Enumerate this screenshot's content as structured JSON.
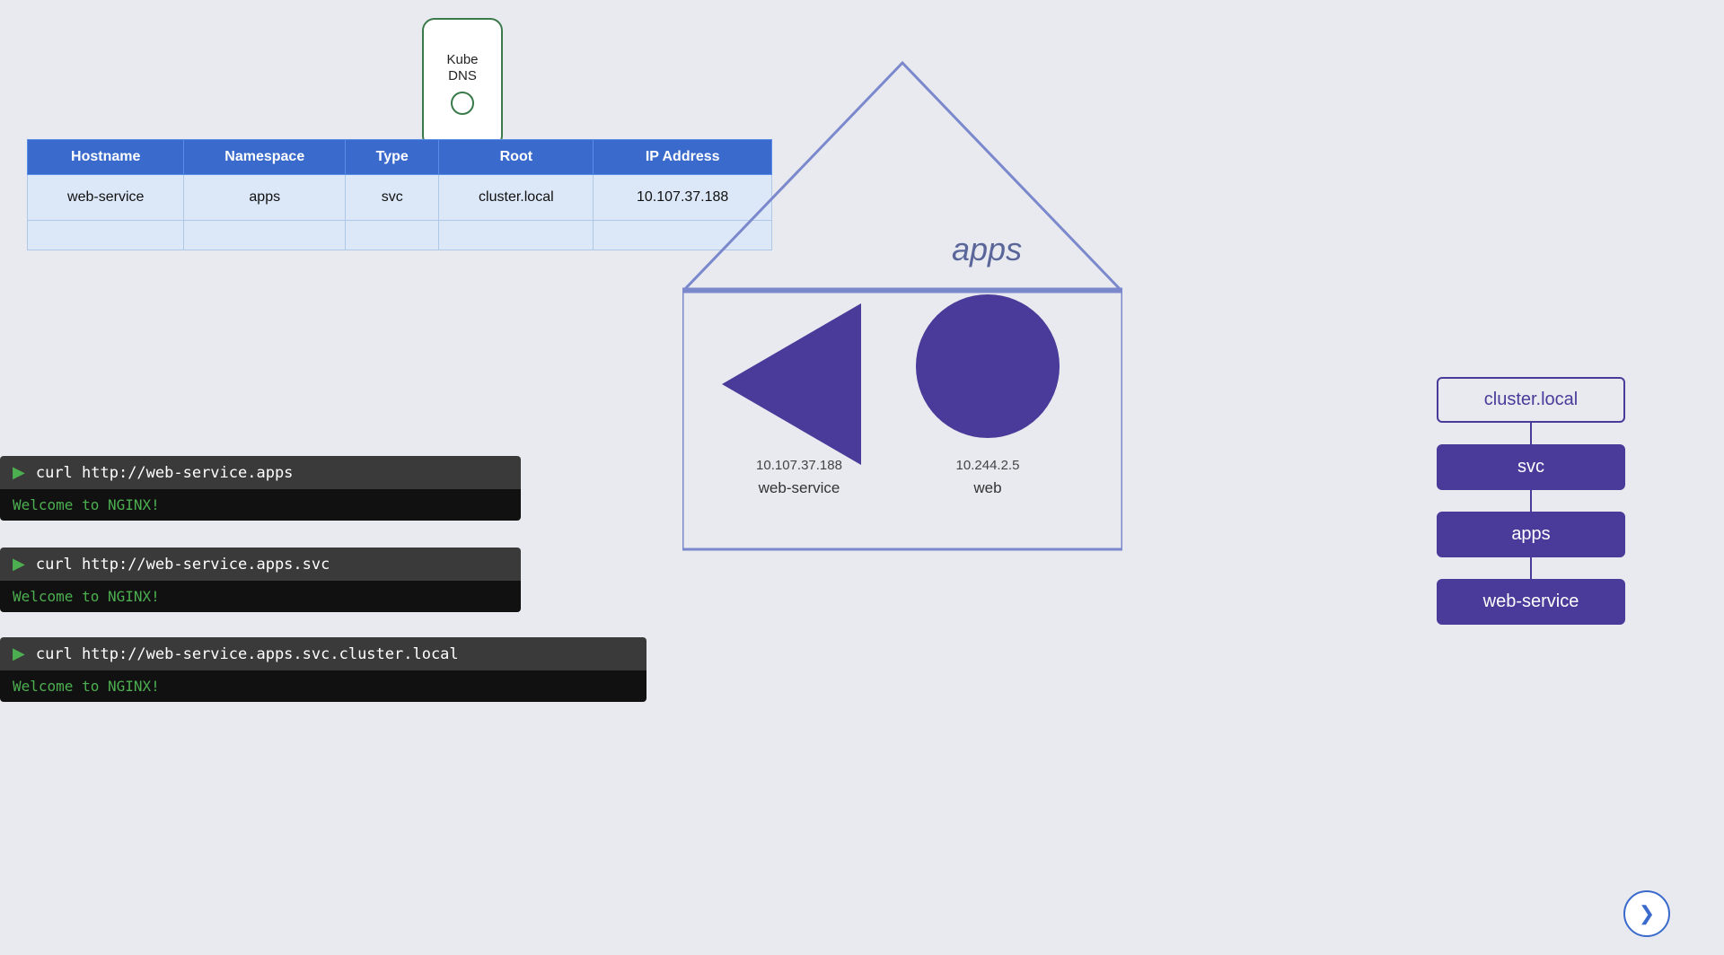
{
  "kubedns": {
    "label": "Kube\nDNS"
  },
  "table": {
    "headers": [
      "Hostname",
      "Namespace",
      "Type",
      "Root",
      "IP Address"
    ],
    "rows": [
      [
        "web-service",
        "apps",
        "svc",
        "cluster.local",
        "10.107.37.188"
      ],
      [
        "",
        "",
        "",
        "",
        ""
      ]
    ]
  },
  "house": {
    "namespace_label": "apps"
  },
  "service": {
    "ip": "10.107.37.188",
    "name": "web-service"
  },
  "pod": {
    "ip": "10.244.2.5",
    "name": "web"
  },
  "terminals": [
    {
      "command": "curl http://web-service.apps",
      "output": "Welcome to NGINX!"
    },
    {
      "command": "curl http://web-service.apps.svc",
      "output": "Welcome to NGINX!"
    },
    {
      "command": "curl http://web-service.apps.svc.cluster.local",
      "output": "Welcome to NGINX!"
    }
  ],
  "dns_hierarchy": [
    {
      "label": "cluster.local",
      "style": "outline"
    },
    {
      "label": "svc",
      "style": "filled"
    },
    {
      "label": "apps",
      "style": "filled"
    },
    {
      "label": "web-service",
      "style": "filled"
    }
  ],
  "nav": {
    "arrow_label": "❯"
  }
}
